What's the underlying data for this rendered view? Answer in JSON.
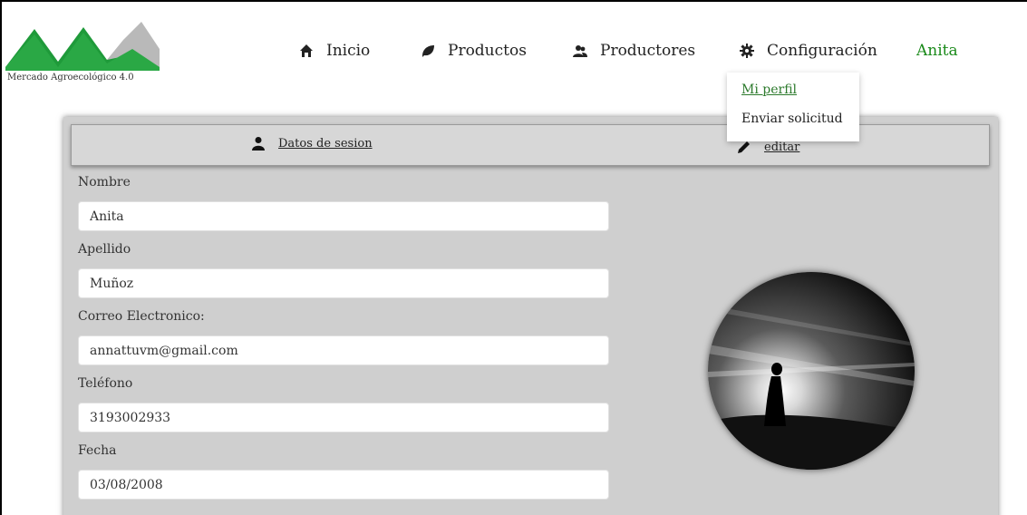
{
  "header": {
    "logo_text": "Mercado Agroecológico 4.0",
    "brand_green": "#1f9a3a",
    "nav": [
      {
        "label": "Inicio",
        "icon": "home-icon"
      },
      {
        "label": "Productos",
        "icon": "leaf-icon"
      },
      {
        "label": "Productores",
        "icon": "users-icon"
      },
      {
        "label": "Configuración",
        "icon": "gear-icon"
      }
    ],
    "user": "Anita"
  },
  "dropdown": {
    "items": [
      "Mi perfil",
      "Enviar solicitud"
    ]
  },
  "panel": {
    "tab_session": "Datos de sesion",
    "tab_edit": "editar",
    "fields": [
      {
        "label": "Nombre",
        "value": "Anita"
      },
      {
        "label": "Apellido",
        "value": "Muñoz"
      },
      {
        "label": "Correo Electronico:",
        "value": "annattuvm@gmail.com"
      },
      {
        "label": "Teléfono",
        "value": "3193002933"
      },
      {
        "label": "Fecha",
        "value": "03/08/2008"
      }
    ]
  }
}
